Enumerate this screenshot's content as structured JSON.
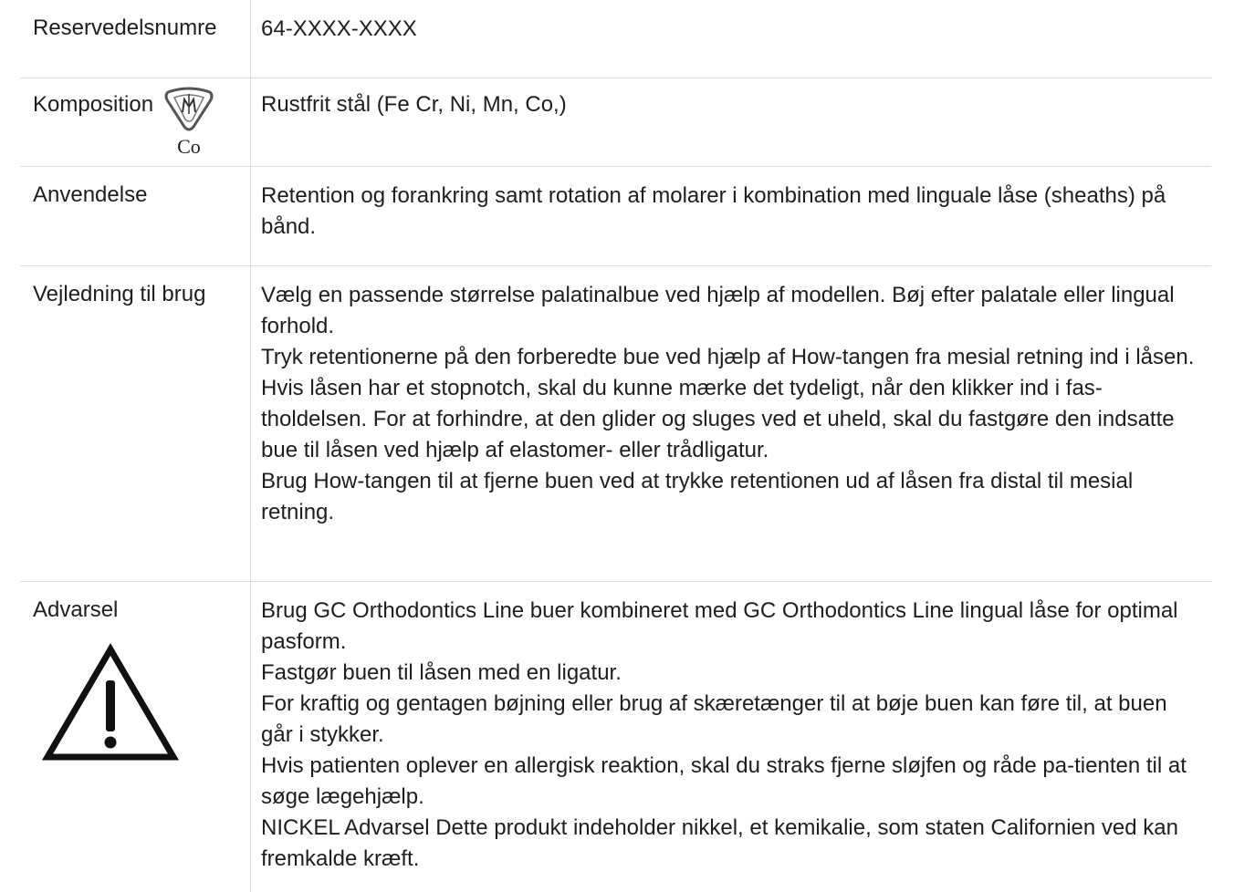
{
  "rows": {
    "spare_part": {
      "label": "Reservedelsnumre",
      "value": "64-XXXX-XXXX"
    },
    "composition": {
      "label": "Komposition",
      "icon": "cobalt-hazard-icon",
      "icon_text": "Co",
      "value": "Rustfrit stål (Fe Cr, Ni, Mn, Co,)"
    },
    "application": {
      "label": "Anvendelse",
      "value": "Retention og forankring samt rotation af molarer i kombination med linguale låse (sheaths) på bånd."
    },
    "instructions": {
      "label": "Vejledning til brug",
      "paragraphs": [
        "Vælg en passende størrelse palatinalbue ved hjælp af modellen. Bøj efter palatale eller lingual forhold.",
        "Tryk retentionerne på den forberedte bue ved hjælp af How-tangen fra mesial retning ind i låsen.",
        "Hvis låsen har et stopnotch, skal du kunne mærke det tydeligt, når den klikker ind i fas-tholdelsen. For at forhindre, at den glider og sluges ved et uheld, skal du fastgøre den indsatte bue til låsen ved hjælp af elastomer- eller trådligatur.",
        "Brug How-tangen til at fjerne buen ved at trykke retentionen ud af låsen fra distal til mesial retning."
      ]
    },
    "warning": {
      "label": "Advarsel",
      "icon": "warning-triangle-icon",
      "paragraphs": [
        "Brug GC Orthodontics Line buer kombineret med GC Orthodontics Line lingual låse for optimal pasform.",
        "Fastgør buen til låsen med en ligatur.",
        "For kraftig og gentagen bøjning eller brug af skæretænger til at bøje buen kan føre til, at buen går i stykker.",
        "Hvis patienten oplever en allergisk reaktion, skal du straks fjerne sløjfen og råde pa-tienten til at søge lægehjælp.",
        "NICKEL Advarsel Dette produkt indeholder nikkel, et kemikalie, som staten Californien ved kan fremkalde kræft."
      ]
    }
  }
}
